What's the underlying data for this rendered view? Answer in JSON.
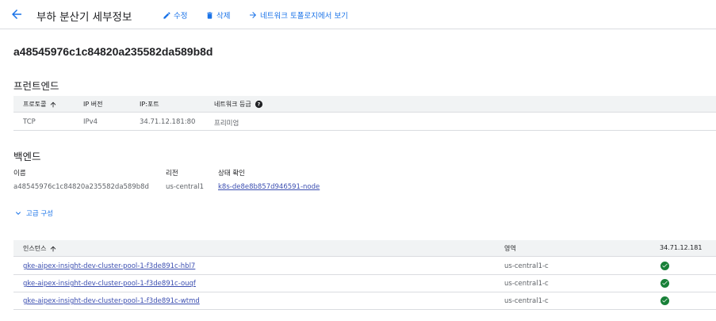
{
  "header": {
    "title": "부하 분산기 세부정보",
    "edit_label": "수정",
    "delete_label": "삭제",
    "topology_label": "네트워크 토폴로지에서 보기"
  },
  "resource_id": "a48545976c1c84820a235582da589b8d",
  "frontend": {
    "title": "프런트엔드",
    "columns": [
      "프로토콜",
      "IP 버전",
      "IP:포트",
      "네트워크 등급"
    ],
    "rows": [
      {
        "protocol": "TCP",
        "ip_version": "IPv4",
        "ip_port": "34.71.12.181:80",
        "tier": "프리미엄"
      }
    ]
  },
  "backend": {
    "title": "백엔드",
    "name_label": "이름",
    "region_label": "리전",
    "health_label": "상태 확인",
    "name_value": "a48545976c1c84820a235582da589b8d",
    "region_value": "us-central1",
    "health_value": "k8s-de8e8b857d946591-node",
    "advanced_label": "고급 구성"
  },
  "instances": {
    "columns": [
      "인스턴스",
      "영역",
      "34.71.12.181"
    ],
    "rows": [
      {
        "name": "gke-aipex-insight-dev-cluster-pool-1-f3de891c-hbl7",
        "zone": "us-central1-c",
        "status": "healthy"
      },
      {
        "name": "gke-aipex-insight-dev-cluster-pool-1-f3de891c-ouqf",
        "zone": "us-central1-c",
        "status": "healthy"
      },
      {
        "name": "gke-aipex-insight-dev-cluster-pool-1-f3de891c-wtmd",
        "zone": "us-central1-c",
        "status": "healthy"
      }
    ]
  },
  "colors": {
    "accent": "#1a73e8",
    "healthy": "#188038",
    "header_bg": "#f1f3f4",
    "divider": "#dadce0"
  }
}
